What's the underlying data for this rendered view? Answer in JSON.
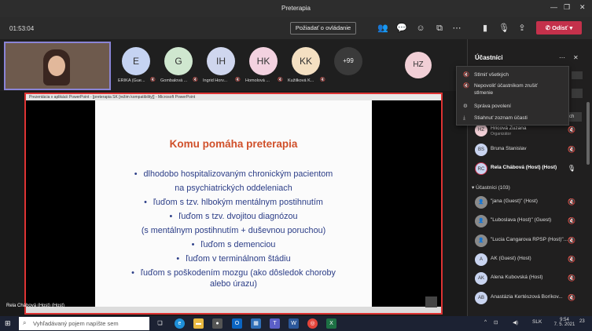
{
  "window": {
    "title": "Preterapia"
  },
  "toolbar": {
    "timer": "01:53:04",
    "request_control": "Požiadať o ovládanie",
    "leave": "Odísť"
  },
  "strip": {
    "avatars": [
      {
        "initials": "E",
        "name": "ERIKA (Gue...",
        "color": "#c5d3f2"
      },
      {
        "initials": "G",
        "name": "Gombalová ...",
        "color": "#cfe7cf"
      },
      {
        "initials": "IH",
        "name": "Ingrid Horv...",
        "color": "#cfd6ee"
      },
      {
        "initials": "HK",
        "name": "Homolová ...",
        "color": "#f3d2e0"
      },
      {
        "initials": "KK",
        "name": "Kužilková K...",
        "color": "#f4e0c2"
      }
    ],
    "more": "+99",
    "hz": "HZ"
  },
  "share": {
    "ppt_title": "Prezentácia v aplikácii PowerPoint - [preterapia SK [režim kompatibility]] - Microsoft PowerPoint",
    "speaker": "Rela Chábová (Host) (Host)",
    "slide": {
      "title": "Komu pomáha preterapia",
      "lines": [
        "dlhodobo hospitalizovaným chronickým pacientom",
        "na psychiatrických oddeleniach",
        "ľuďom s tzv. hlbokým mentálnym postihnutím",
        "ľuďom s tzv. dvojitou diagnózou",
        "(s mentálnym postihnutím + duševnou poruchou)",
        "ľuďom s demenciou",
        "ľuďom v terminálnom štádiu",
        "ľuďom s poškodením mozgu (ako dôsledok choroby",
        "alebo úrazu)"
      ]
    }
  },
  "panel": {
    "title": "Účastníci",
    "menu": [
      "Stlmiť všetkých",
      "Nepovoliť účastníkom zrušiť stlmenie",
      "Správa povolení",
      "Stiahnuť zoznam účasti"
    ],
    "menu_partial": "ch",
    "organizer": {
      "name": "Hricová Zuzana",
      "role": "Organizátor",
      "initials": "HZ"
    },
    "presenters": [
      {
        "initials": "BS",
        "name": "Bruna Stanislav"
      },
      {
        "initials": "RC",
        "name": "Rela Chábová (Host) (Host)"
      }
    ],
    "attendees_label": "Účastníci (103)",
    "attendees": [
      {
        "initials": "",
        "name": "\"jana (Guest)\" (Host)"
      },
      {
        "initials": "",
        "name": "\"Luboslava (Host)\" (Guest)"
      },
      {
        "initials": "",
        "name": "\"Lucia Cangarova RPSP (Host)\"..."
      },
      {
        "initials": "A",
        "name": "AK (Guest) (Host)"
      },
      {
        "initials": "AK",
        "name": "Alena Kubovská (Host)"
      },
      {
        "initials": "AB",
        "name": "Anastázia Kertészová Boríkov..."
      }
    ]
  },
  "taskbar": {
    "search_placeholder": "Vyhľadávaný pojem napíšte sem",
    "lang": "SLK",
    "time": "9:54",
    "date": "7. 5. 2021",
    "notif": "23"
  }
}
